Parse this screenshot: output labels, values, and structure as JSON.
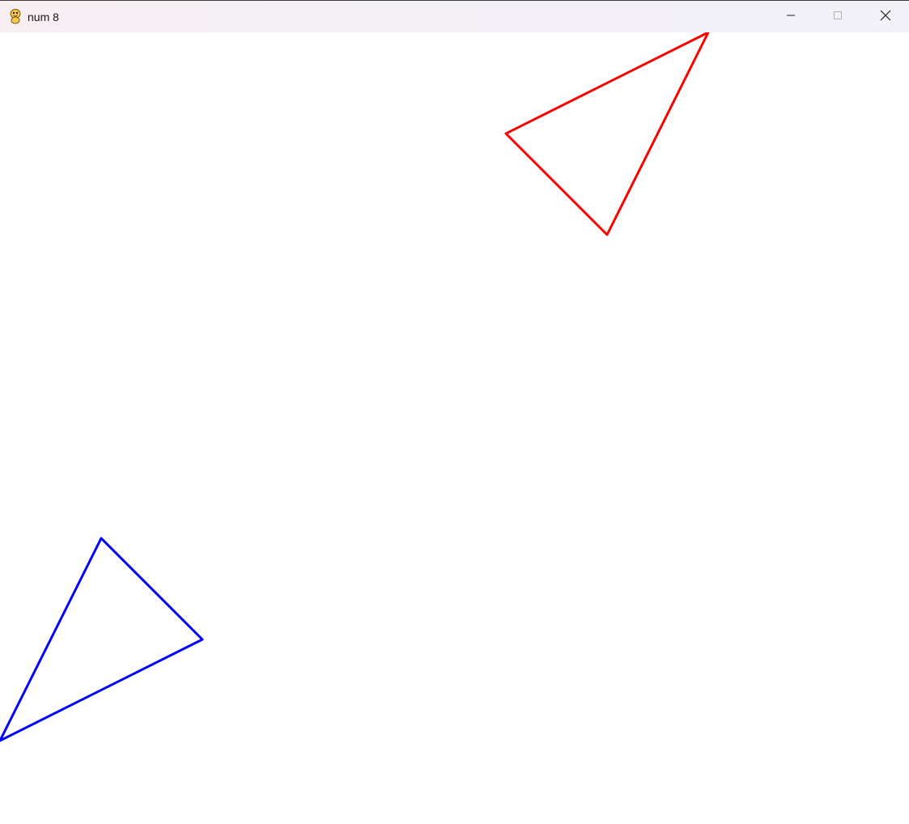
{
  "window": {
    "title": "num 8",
    "app_icon": "python-icon",
    "controls": {
      "minimize_icon": "minimize-icon",
      "maximize_icon": "maximize-icon",
      "close_icon": "close-icon"
    }
  },
  "canvas": {
    "background": "#ffffff",
    "shapes": [
      {
        "name": "red-triangle",
        "color": "#ff0000"
      },
      {
        "name": "blue-triangle",
        "color": "#0000ff"
      }
    ]
  }
}
